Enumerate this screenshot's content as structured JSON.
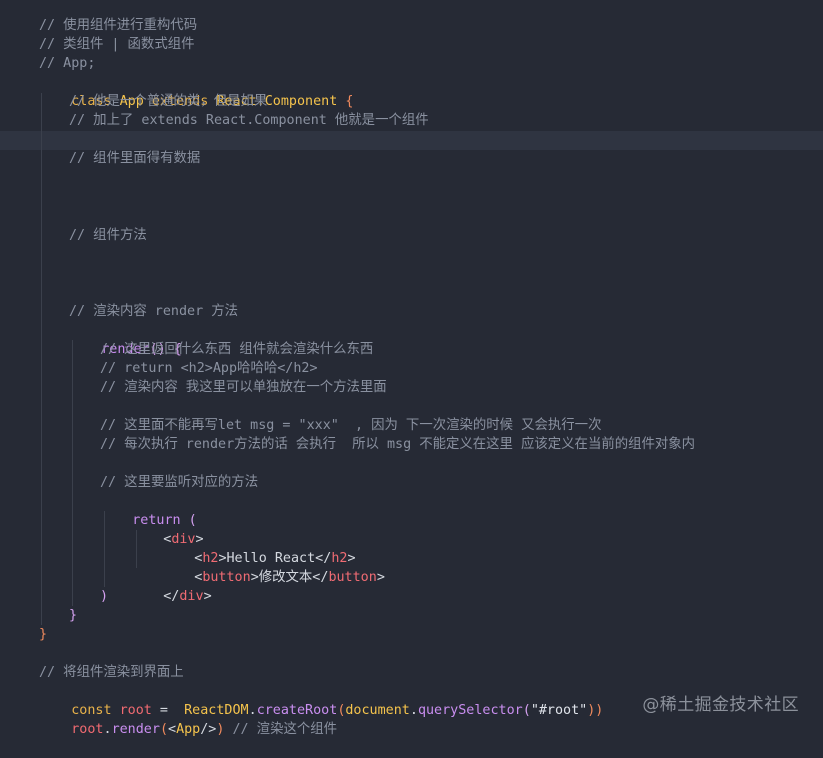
{
  "editor": {
    "language": "javascript",
    "theme_colors": {
      "background": "#262a35",
      "comment": "#8a91a0",
      "keyword": "#e8b24a",
      "function": "#c98ef0",
      "variable": "#f06a71",
      "tag": "#ef6b73"
    },
    "lines": [
      {
        "text": "// 使用组件进行重构代码"
      },
      {
        "text": "// 类组件 | 函数式组件"
      },
      {
        "text": "// App;"
      },
      {
        "t1": "class ",
        "t2": "App",
        "t3": " extends ",
        "t4": "React.Component",
        "t5": " {"
      },
      {
        "text": "// 他是一个普通的类，但是如果"
      },
      {
        "text": "// 加上了 extends React.Component 他就是一个组件"
      },
      {
        "text": "// 组件里面得有数据"
      },
      {
        "text": "// 组件方法"
      },
      {
        "text": "// 渲染内容 render 方法"
      },
      {
        "t1": "render",
        "t2": "()",
        "t3": " {"
      },
      {
        "text": "// 这里返回什么东西 组件就会渲染什么东西"
      },
      {
        "text": "// return <h2>App哈哈哈</h2>"
      },
      {
        "text": "// 渲染内容 我这里可以单独放在一个方法里面"
      },
      {
        "text": "// 这里面不能再写let msg = \"xxx\"  , 因为 下一次渲染的时候 又会执行一次"
      },
      {
        "text": "// 每次执行 render方法的话 会执行  所以 msg 不能定义在这里 应该定义在当前的组件对象内"
      },
      {
        "text": "// 这里要监听对应的方法"
      },
      {
        "t1": "return",
        "t2": " ("
      },
      {
        "t1": "<",
        "t2": "div",
        "t3": ">"
      },
      {
        "t1": "<",
        "t2": "h2",
        "t3": ">Hello React</",
        "t4": "h2",
        "t5": ">"
      },
      {
        "t1": "<",
        "t2": "button",
        "t3": ">修改文本</",
        "t4": "button",
        "t5": ">"
      },
      {
        "t1": "</",
        "t2": "div",
        "t3": ">"
      },
      {
        "text": ")"
      },
      {
        "text": "}"
      },
      {
        "text": "}"
      },
      {
        "text": "// 将组件渲染到界面上"
      },
      {
        "t1": "const ",
        "t2": "root",
        "t3": " =  ",
        "t4": "ReactDOM",
        "t5": ".",
        "t6": "createRoot",
        "t7": "(",
        "t8": "document",
        "t9": ".",
        "t10": "querySelector",
        "t11": "(",
        "t12": "\"#root\"",
        "t13": "))"
      },
      {
        "t1": "root",
        "t2": ".",
        "t3": "render",
        "t4": "(",
        "t5": "<",
        "t6": "App",
        "t7": "/>",
        "t8": ")",
        "t9": " // 渲染这个组件"
      }
    ]
  },
  "watermark": "@稀土掘金技术社区"
}
